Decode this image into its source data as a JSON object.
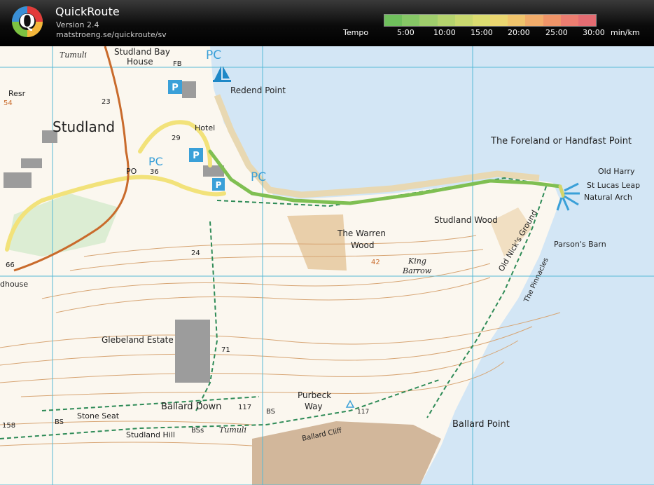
{
  "header": {
    "app_name": "QuickRoute",
    "version": "Version 2.4",
    "url": "matstroeng.se/quickroute/sv",
    "tempo_label": "Tempo",
    "ticks": [
      "5:00",
      "10:00",
      "15:00",
      "20:00",
      "25:00",
      "30:00"
    ],
    "unit": "min/km",
    "colors": [
      "#6fbf5c",
      "#86c766",
      "#9fcd6c",
      "#b5d36e",
      "#c9d86f",
      "#dbdc70",
      "#ead670",
      "#f0c46c",
      "#f1ac6a",
      "#ef9468",
      "#ec7d70",
      "#e46c72"
    ]
  },
  "map": {
    "labels": {
      "tumuli_top": "Tumuli",
      "studland_bay_house_1": "Studland Bay",
      "studland_bay_house_2": "House",
      "pc_top": "PC",
      "fb": "FB",
      "redend_point": "Redend Point",
      "resr": "Resr",
      "spot_54": "54",
      "spot_23": "23",
      "studland": "Studland",
      "spot_29": "29",
      "hotel": "Hotel",
      "po": "PO",
      "spot_36": "36",
      "pc_mid": "PC",
      "pc_right": "PC",
      "foreland": "The Foreland or Handfast Point",
      "old_harry": "Old Harry",
      "st_lucas_leap": "St Lucas Leap",
      "natural_arch": "Natural Arch",
      "studland_wood": "Studland Wood",
      "warren_wood_1": "The Warren",
      "warren_wood_2": "Wood",
      "parsons_barn": "Parson's Barn",
      "old_nicks_ground": "Old Nick's Ground",
      "the_pinnacles": "The Pinnacles",
      "king_barrow_1": "King",
      "king_barrow_2": "Barrow",
      "spot_42": "42",
      "spot_24": "24",
      "spot_66": "66",
      "dhouse": "dhouse",
      "glebeland_estate": "Glebeland Estate",
      "spot_71": "71",
      "ballard_down": "Ballard Down",
      "spot_117": "117",
      "bs_1": "BS",
      "purbeck_1": "Purbeck",
      "purbeck_2": "Way",
      "spot_117b": "117",
      "stone_seat": "Stone Seat",
      "spot_158": "158",
      "bs_2": "BS",
      "studland_hill": "Studland Hill",
      "bss": "BSs",
      "tumuli_bottom": "Tumuli",
      "ballard_cliff": "Ballard Cliff",
      "ballard_point": "Ballard Point"
    }
  }
}
